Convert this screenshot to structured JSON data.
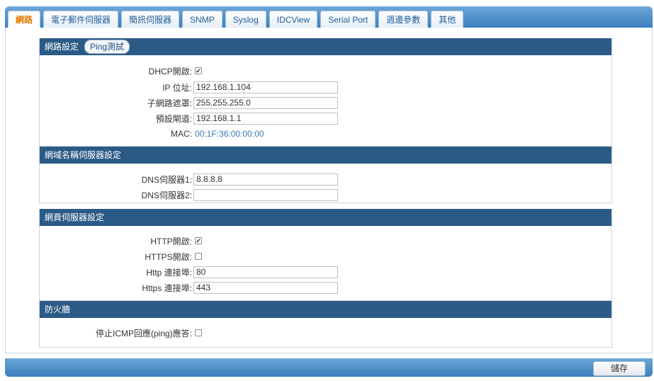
{
  "tabs": [
    "網路",
    "電子郵件伺服器",
    "簡訊伺服器",
    "SNMP",
    "Syslog",
    "IDCView",
    "Serial Port",
    "週邊參數",
    "其他"
  ],
  "network": {
    "title": "網路設定",
    "ping_button": "Ping測試",
    "dhcp_label": "DHCP開啟:",
    "dhcp_checked": "✔",
    "ip_label": "IP 位址:",
    "ip_value": "192.168.1.104",
    "mask_label": "子網路遮罩:",
    "mask_value": "255.255.255.0",
    "gateway_label": "預設閘道:",
    "gateway_value": "192.168.1.1",
    "mac_label": "MAC:",
    "mac_value": "00:1F:36:00:00:00"
  },
  "dns": {
    "title": "網域名稱伺服器設定",
    "dns1_label": "DNS伺服器1:",
    "dns1_value": "8.8.8.8",
    "dns2_label": "DNS伺服器2:",
    "dns2_value": ""
  },
  "web": {
    "title": "網頁伺服器設定",
    "http_label": "HTTP開啟:",
    "http_checked": "✔",
    "https_label": "HTTPS開啟:",
    "http_port_label": "Http 連接埠:",
    "http_port_value": "80",
    "https_port_label": "Https 連接埠:",
    "https_port_value": "443"
  },
  "firewall": {
    "title": "防火牆",
    "icmp_label": "停止ICMP回應(ping)應答:"
  },
  "save_label": "儲存"
}
